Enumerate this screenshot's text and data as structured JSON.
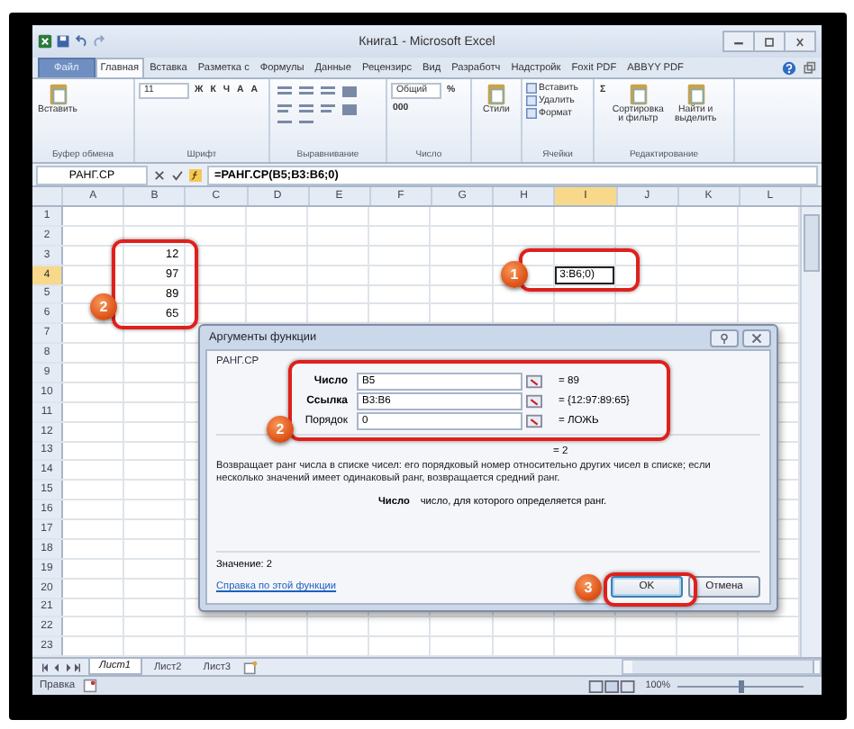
{
  "window": {
    "title": "Книга1 - Microsoft Excel"
  },
  "ribbon_tabs": [
    {
      "label": "Файл",
      "selected": false,
      "kind": "file"
    },
    {
      "label": "Главная",
      "selected": true,
      "kind": "tab"
    },
    {
      "label": "Вставка",
      "selected": false,
      "kind": "tab"
    },
    {
      "label": "Разметка с",
      "selected": false,
      "kind": "tab"
    },
    {
      "label": "Формулы",
      "selected": false,
      "kind": "tab"
    },
    {
      "label": "Данные",
      "selected": false,
      "kind": "tab"
    },
    {
      "label": "Рецензирс",
      "selected": false,
      "kind": "tab"
    },
    {
      "label": "Вид",
      "selected": false,
      "kind": "tab"
    },
    {
      "label": "Разработч",
      "selected": false,
      "kind": "tab"
    },
    {
      "label": "Надстройк",
      "selected": false,
      "kind": "tab"
    },
    {
      "label": "Foxit PDF",
      "selected": false,
      "kind": "tab"
    },
    {
      "label": "ABBYY PDF",
      "selected": false,
      "kind": "tab"
    }
  ],
  "ribbon_groups": [
    {
      "label": "Буфер обмена",
      "items": [
        {
          "kind": "big",
          "text": "Вставить"
        }
      ]
    },
    {
      "label": "Шрифт",
      "items": [
        {
          "kind": "field",
          "text": "11"
        },
        {
          "kind": "glyph",
          "text": "Ж"
        },
        {
          "kind": "glyph",
          "text": "К"
        },
        {
          "kind": "glyph",
          "text": "Ч"
        },
        {
          "kind": "glyph",
          "text": "A"
        },
        {
          "kind": "glyph",
          "text": "A"
        }
      ]
    },
    {
      "label": "Выравнивание"
    },
    {
      "label": "Число",
      "items": [
        {
          "kind": "field",
          "text": "Общий"
        },
        {
          "kind": "glyph",
          "text": "%"
        },
        {
          "kind": "glyph",
          "text": "000"
        }
      ]
    },
    {
      "items": [
        {
          "kind": "big",
          "text": "Стили"
        }
      ]
    },
    {
      "label": "Ячейки",
      "items": [
        {
          "kind": "small",
          "text": "Вставить"
        },
        {
          "kind": "small",
          "text": "Удалить"
        },
        {
          "kind": "small",
          "text": "Формат"
        }
      ]
    },
    {
      "label": "Редактирование",
      "items": [
        {
          "kind": "glyph",
          "text": "Σ"
        },
        {
          "kind": "big",
          "text": "Сортировка и фильтр"
        },
        {
          "kind": "big",
          "text": "Найти и выделить"
        }
      ]
    }
  ],
  "formula_bar": {
    "name_box": "РАНГ.СР",
    "formula": "=РАНГ.СР(B5;B3:B6;0)"
  },
  "columns": [
    {
      "label": "A",
      "selected": false
    },
    {
      "label": "B",
      "selected": false
    },
    {
      "label": "C",
      "selected": false
    },
    {
      "label": "D",
      "selected": false
    },
    {
      "label": "E",
      "selected": false
    },
    {
      "label": "F",
      "selected": false
    },
    {
      "label": "G",
      "selected": false
    },
    {
      "label": "H",
      "selected": false
    },
    {
      "label": "I",
      "selected": true
    },
    {
      "label": "J",
      "selected": false
    },
    {
      "label": "K",
      "selected": false
    },
    {
      "label": "L",
      "selected": false
    }
  ],
  "rows": [
    {
      "label": "1",
      "selected": false
    },
    {
      "label": "2",
      "selected": false
    },
    {
      "label": "3",
      "selected": false,
      "b": "12"
    },
    {
      "label": "4",
      "selected": true,
      "b": "97",
      "i": "3:B6;0)"
    },
    {
      "label": "5",
      "selected": false,
      "b": "89"
    },
    {
      "label": "6",
      "selected": false,
      "b": "65"
    },
    {
      "label": "7",
      "selected": false
    },
    {
      "label": "8",
      "selected": false
    },
    {
      "label": "9",
      "selected": false
    },
    {
      "label": "10",
      "selected": false
    },
    {
      "label": "11",
      "selected": false
    },
    {
      "label": "12",
      "selected": false
    },
    {
      "label": "13",
      "selected": false
    },
    {
      "label": "14",
      "selected": false
    },
    {
      "label": "15",
      "selected": false
    },
    {
      "label": "16",
      "selected": false
    },
    {
      "label": "17",
      "selected": false
    },
    {
      "label": "18",
      "selected": false
    },
    {
      "label": "19",
      "selected": false
    },
    {
      "label": "20",
      "selected": false
    },
    {
      "label": "21",
      "selected": false
    },
    {
      "label": "22",
      "selected": false
    },
    {
      "label": "23",
      "selected": false
    }
  ],
  "dialog": {
    "title": "Аргументы функции",
    "function_name": "РАНГ.СР",
    "arguments": [
      {
        "label": "Число",
        "value": "B5",
        "result": "= 89",
        "required": true
      },
      {
        "label": "Ссылка",
        "value": "B3:B6",
        "result": "= {12:97:89:65}",
        "required": true
      },
      {
        "label": "Порядок",
        "value": "0",
        "result": "= ЛОЖЬ",
        "required": false
      }
    ],
    "result": "= 2",
    "description": "Возвращает ранг числа в списке чисел: его порядковый номер относительно других чисел в списке; если несколько значений имеет одинаковый ранг, возвращается средний ранг.",
    "argument_help": {
      "name": "Число",
      "text": "число, для которого определяется ранг."
    },
    "value_line": "Значение:  2",
    "help_link": "Справка по этой функции",
    "buttons": [
      {
        "label": "OK",
        "default": true
      },
      {
        "label": "Отмена",
        "default": false
      }
    ]
  },
  "callouts": [
    {
      "number": "1"
    },
    {
      "number": "2"
    },
    {
      "number": "2"
    },
    {
      "number": "3"
    }
  ],
  "sheet_tabs": [
    {
      "label": "Лист1",
      "selected": true
    },
    {
      "label": "Лист2",
      "selected": false
    },
    {
      "label": "Лист3",
      "selected": false
    }
  ],
  "status_bar": {
    "mode": "Правка",
    "zoom": "100%",
    "zoom_slider": {
      "level": 0.5
    }
  }
}
